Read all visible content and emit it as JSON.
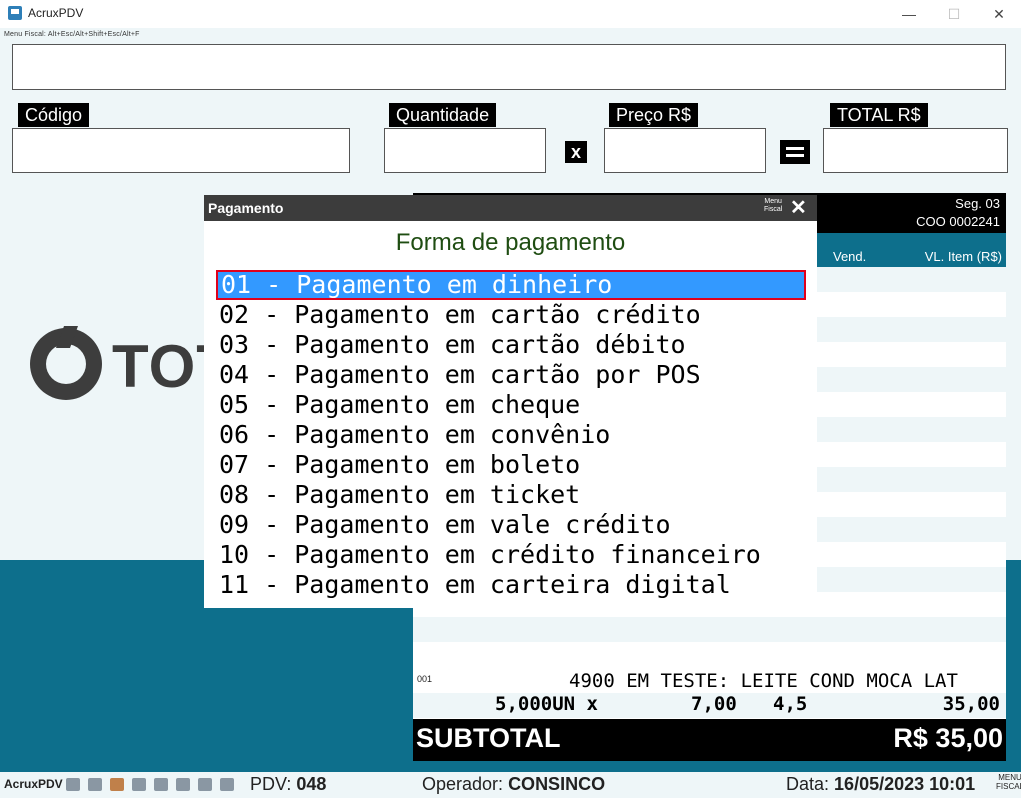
{
  "window": {
    "title": "AcruxPDV",
    "minimize": "—",
    "maximize": "☐",
    "close": "✕"
  },
  "menu_hint": "Menu Fiscal: Alt+Esc/Alt+Shift+Esc/Alt+F",
  "fields": {
    "codigo_label": "Código",
    "quantidade_label": "Quantidade",
    "preco_label": "Preço R$",
    "total_label": "TOTAL R$",
    "multiply_sign": "x"
  },
  "logo": {
    "text": "TOT"
  },
  "cupom": {
    "seg": "Seg. 03",
    "coo": "COO 0002241",
    "col_vend": "Vend.",
    "col_vl_item": "VL. Item (R$)",
    "item": {
      "number": "001",
      "description": "4900 EM TESTE: LEITE COND MOCA LAT",
      "qty": "5,000UN x",
      "unit_price": "7,00",
      "vend": "4,5",
      "total": "35,00"
    },
    "subtotal_label": "SUBTOTAL",
    "subtotal_value": "R$ 35,00"
  },
  "dialog": {
    "title": "Pagamento",
    "menu_fiscal_1": "Menu",
    "menu_fiscal_2": "Fiscal",
    "close": "✕",
    "heading": "Forma de pagamento",
    "options": [
      "01 - Pagamento em dinheiro",
      "02 - Pagamento em cartão crédito",
      "03 - Pagamento em cartão débito",
      "04 - Pagamento em cartão por POS",
      "05 - Pagamento em cheque",
      "06 - Pagamento em convênio",
      "07 - Pagamento em boleto",
      "08 - Pagamento em ticket",
      "09 - Pagamento em vale crédito",
      "10 - Pagamento em crédito financeiro",
      "11 - Pagamento em carteira digital"
    ],
    "selected_index": 0
  },
  "statusbar": {
    "app": "AcruxPDV",
    "pdv_label": "PDV:",
    "pdv_value": "048",
    "operador_label": "Operador:",
    "operador_value": "CONSINCO",
    "data_label": "Data:",
    "data_value": "16/05/2023 10:01",
    "menu_fiscal_1": "MENU",
    "menu_fiscal_2": "FISCAL"
  },
  "colors": {
    "accent_blue": "#0d6f8c",
    "selection": "#3399ff",
    "selection_border": "#e0001b",
    "heading": "#1f4d12"
  }
}
